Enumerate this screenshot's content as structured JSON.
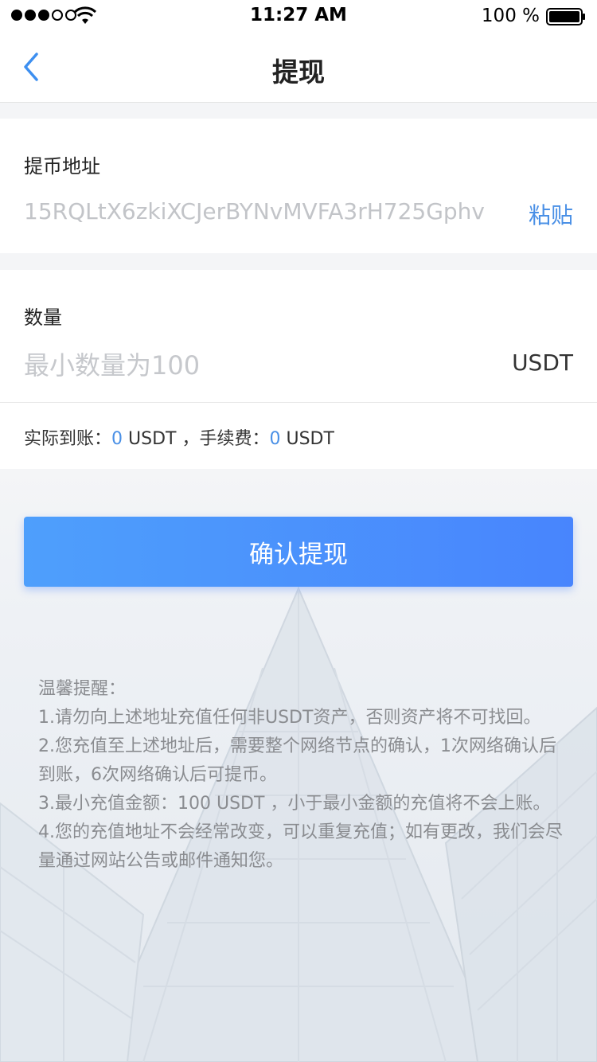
{
  "status_bar": {
    "time": "11:27 AM",
    "battery_percent": "100 %",
    "signal_strength": 3,
    "signal_max": 5,
    "icons": [
      "signal-dots-icon",
      "wifi-icon",
      "battery-icon"
    ]
  },
  "nav": {
    "title": "提现",
    "back_icon": "chevron-left-icon"
  },
  "address": {
    "label": "提币地址",
    "value": "15RQLtX6zkiXCJerBYNvMVFA3rH725Gphv",
    "paste_label": "粘贴"
  },
  "amount": {
    "label": "数量",
    "placeholder": "最小数量为100",
    "unit": "USDT",
    "summary": {
      "received_label": "实际到账：",
      "received_value": "0",
      "received_unit": " USDT ",
      "fee_label": "，手续费：",
      "fee_value": "0",
      "fee_unit": " USDT"
    }
  },
  "confirm_button_label": "确认提现",
  "tips": {
    "title": "温馨提醒：",
    "items": [
      "1.请勿向上述地址充值任何非USDT资产，否则资产将不可找回。",
      "2.您充值至上述地址后，需要整个网络节点的确认，1次网络确认后到账，6次网络确认后可提币。",
      "3.最小充值金额：100 USDT ，小于最小金额的充值将不会上账。",
      "4.您的充值地址不会经常改变，可以重复充值；如有更改，我们会尽量通过网站公告或邮件通知您。"
    ]
  },
  "colors": {
    "accent": "#4a90e6",
    "button_start": "#4e9ffc",
    "button_end": "#4885fd",
    "placeholder": "#c2c4c8",
    "tips_text": "#8a8c90",
    "page_bg": "#f4f5f7"
  }
}
